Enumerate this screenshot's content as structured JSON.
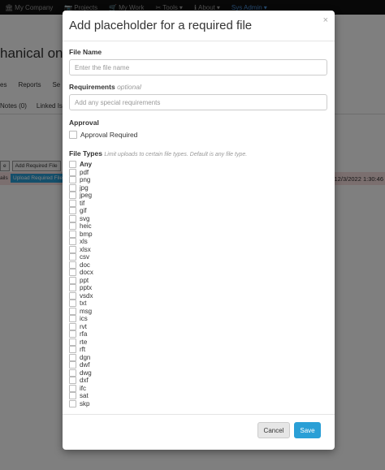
{
  "background": {
    "nav": [
      {
        "icon": "bank-icon",
        "label": "My Company"
      },
      {
        "icon": "camera-icon",
        "label": "Projects"
      },
      {
        "icon": "cart-icon",
        "label": "My Work"
      },
      {
        "icon": "wrench-icon",
        "label": "Tools"
      },
      {
        "icon": "info-icon",
        "label": "About"
      },
      {
        "icon": "",
        "label": "Sys Admin"
      }
    ],
    "title": "hanical on",
    "tabs": [
      "es",
      "Reports",
      "Se"
    ],
    "subtabs": [
      "Notes (0)",
      "Linked Is"
    ],
    "buttons": [
      "e",
      "Add Required File"
    ],
    "row": {
      "label": "ails",
      "button": "Upload Required File",
      "date": "12/3/2022 1:30:46"
    }
  },
  "modal": {
    "title": "Add placeholder for a required file",
    "close": "×",
    "file_name": {
      "label": "File Name",
      "placeholder": "Enter the file name",
      "value": ""
    },
    "requirements": {
      "label": "Requirements",
      "hint": "optional",
      "placeholder": "Add any special requirements",
      "value": ""
    },
    "approval": {
      "label": "Approval",
      "checkbox_label": "Approval Required",
      "checked": false
    },
    "file_types": {
      "label": "File Types",
      "hint": "Limit uploads to certain file types. Default is any file type.",
      "options": [
        "Any",
        "pdf",
        "png",
        "jpg",
        "jpeg",
        "tif",
        "gif",
        "svg",
        "heic",
        "bmp",
        "xls",
        "xlsx",
        "csv",
        "doc",
        "docx",
        "ppt",
        "pptx",
        "vsdx",
        "txt",
        "msg",
        "ics",
        "rvt",
        "rfa",
        "rte",
        "rft",
        "dgn",
        "dwf",
        "dwg",
        "dxf",
        "ifc",
        "sat",
        "skp"
      ]
    },
    "cancel_label": "Cancel",
    "save_label": "Save"
  }
}
